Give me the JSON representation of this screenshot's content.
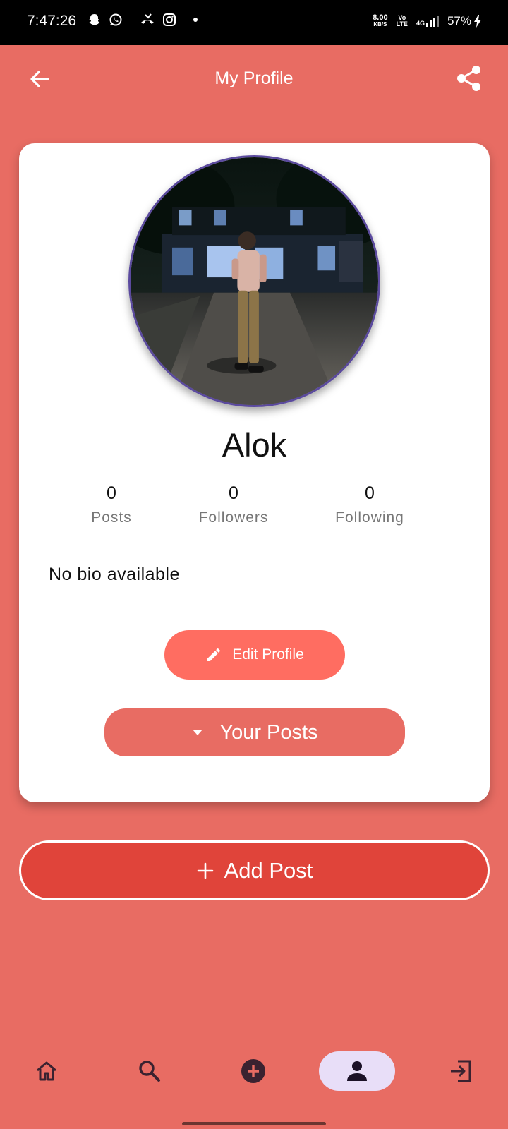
{
  "status_bar": {
    "time": "7:47:26",
    "net_speed_value": "8.00",
    "net_speed_unit": "KB/S",
    "volte_line1": "Vo",
    "volte_line2": "LTE",
    "network": "4G",
    "battery": "57%"
  },
  "header": {
    "title": "My Profile"
  },
  "profile": {
    "name": "Alok",
    "bio": "No bio available",
    "stats": [
      {
        "value": "0",
        "label": "Posts"
      },
      {
        "value": "0",
        "label": "Followers"
      },
      {
        "value": "0",
        "label": "Following"
      }
    ]
  },
  "actions": {
    "edit_profile": "Edit Profile",
    "your_posts": "Your Posts",
    "add_post": "Add Post"
  },
  "bottom_nav": {
    "items": [
      {
        "icon": "home-icon"
      },
      {
        "icon": "search-icon"
      },
      {
        "icon": "add-circle-icon"
      },
      {
        "icon": "person-icon",
        "active": true
      },
      {
        "icon": "logout-icon"
      }
    ]
  },
  "colors": {
    "background": "#E86C63",
    "edit_button": "#FF6D61",
    "add_post_button": "#E0443A",
    "active_nav": "#E8DEF8",
    "avatar_border": "#5B4A9E"
  }
}
